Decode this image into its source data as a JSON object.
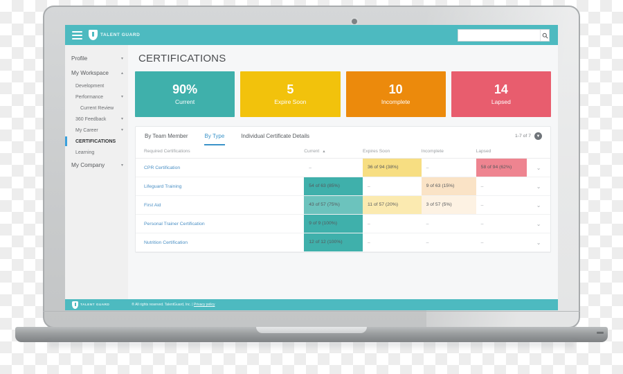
{
  "header": {
    "brand": "TALENT GUARD",
    "menu_icon": "hamburger-icon",
    "logo_icon": "shield-logo-icon",
    "search": {
      "value": "",
      "placeholder": "",
      "icon": "search-icon"
    }
  },
  "sidebar": {
    "items": [
      {
        "label": "Profile",
        "level": "top",
        "caret": "▾",
        "active": false
      },
      {
        "label": "My Workspace",
        "level": "top",
        "caret": "▴",
        "active": false
      },
      {
        "label": "Development",
        "level": "sub",
        "caret": "",
        "active": false
      },
      {
        "label": "Performance",
        "level": "sub",
        "caret": "▾",
        "active": false
      },
      {
        "label": "Current Review",
        "level": "sub2",
        "caret": "",
        "active": false
      },
      {
        "label": "360 Feedback",
        "level": "sub",
        "caret": "▾",
        "active": false
      },
      {
        "label": "My Career",
        "level": "sub",
        "caret": "▾",
        "active": false
      },
      {
        "label": "CERTIFICATIONS",
        "level": "sub",
        "caret": "",
        "active": true
      },
      {
        "label": "Learning",
        "level": "sub",
        "caret": "",
        "active": false
      },
      {
        "label": "My Company",
        "level": "top",
        "caret": "▾",
        "active": false
      }
    ]
  },
  "main": {
    "page_title": "CERTIFICATIONS",
    "kpis": [
      {
        "value": "90%",
        "label": "Current",
        "color": "#3fb0ab"
      },
      {
        "value": "5",
        "label": "Expire Soon",
        "color": "#f2c20c"
      },
      {
        "value": "10",
        "label": "Incomplete",
        "color": "#ec8a0c"
      },
      {
        "value": "14",
        "label": "Lapsed",
        "color": "#e85d6e"
      }
    ],
    "tabs": [
      {
        "label": "By Team Member",
        "active": false
      },
      {
        "label": "By Type",
        "active": true
      },
      {
        "label": "Individual Certificate Details",
        "active": false
      }
    ],
    "pagination": {
      "text": "1-7 of 7",
      "button_icon": "chevron-down-icon"
    },
    "table": {
      "columns": [
        "Required Certifications",
        "Current",
        "Expires Soon",
        "Incomplete",
        "Lapsed"
      ],
      "sorted_column": "Current",
      "sort_direction": "▲",
      "row_icon": "chevron-down-icon",
      "rows": [
        {
          "name": "CPR Certification",
          "current": {
            "text": "–",
            "fill": "none"
          },
          "expires": {
            "text": "36 of 94 (38%)",
            "fill": "#f7de82"
          },
          "incomplete": {
            "text": "–",
            "fill": "none"
          },
          "lapsed": {
            "text": "58 of 94 (62%)",
            "fill": "#ee8490"
          }
        },
        {
          "name": "Lifeguard Training",
          "current": {
            "text": "54 of 63 (85%)",
            "fill": "#3fb0ab"
          },
          "expires": {
            "text": "–",
            "fill": "none"
          },
          "incomplete": {
            "text": "9 of 63 (15%)",
            "fill": "#fae3c6"
          },
          "lapsed": {
            "text": "–",
            "fill": "none"
          }
        },
        {
          "name": "First Aid",
          "current": {
            "text": "43 of 57 (75%)",
            "fill": "#6cc3bd"
          },
          "expires": {
            "text": "11 of 57 (20%)",
            "fill": "#fbeab0"
          },
          "incomplete": {
            "text": "3 of 57 (5%)",
            "fill": "#fdf2e3"
          },
          "lapsed": {
            "text": "–",
            "fill": "none"
          }
        },
        {
          "name": "Personal Trainer Certification",
          "current": {
            "text": "9 of 9 (100%)",
            "fill": "#3fb0ab"
          },
          "expires": {
            "text": "–",
            "fill": "none"
          },
          "incomplete": {
            "text": "–",
            "fill": "none"
          },
          "lapsed": {
            "text": "–",
            "fill": "none"
          }
        },
        {
          "name": "Nutrition Certification",
          "current": {
            "text": "12 of 12 (100%)",
            "fill": "#3fb0ab"
          },
          "expires": {
            "text": "–",
            "fill": "none"
          },
          "incomplete": {
            "text": "–",
            "fill": "none"
          },
          "lapsed": {
            "text": "–",
            "fill": "none"
          }
        }
      ]
    }
  },
  "footer": {
    "brand": "TALENT GUARD",
    "copyright": "® All rights reserved. TalentGuard, Inc. | ",
    "privacy_link": "Privacy policy"
  },
  "theme": {
    "teal": "#4dbac0",
    "accent_blue": "#3a93c9",
    "sidebar_bg": "#f0f0f0"
  }
}
